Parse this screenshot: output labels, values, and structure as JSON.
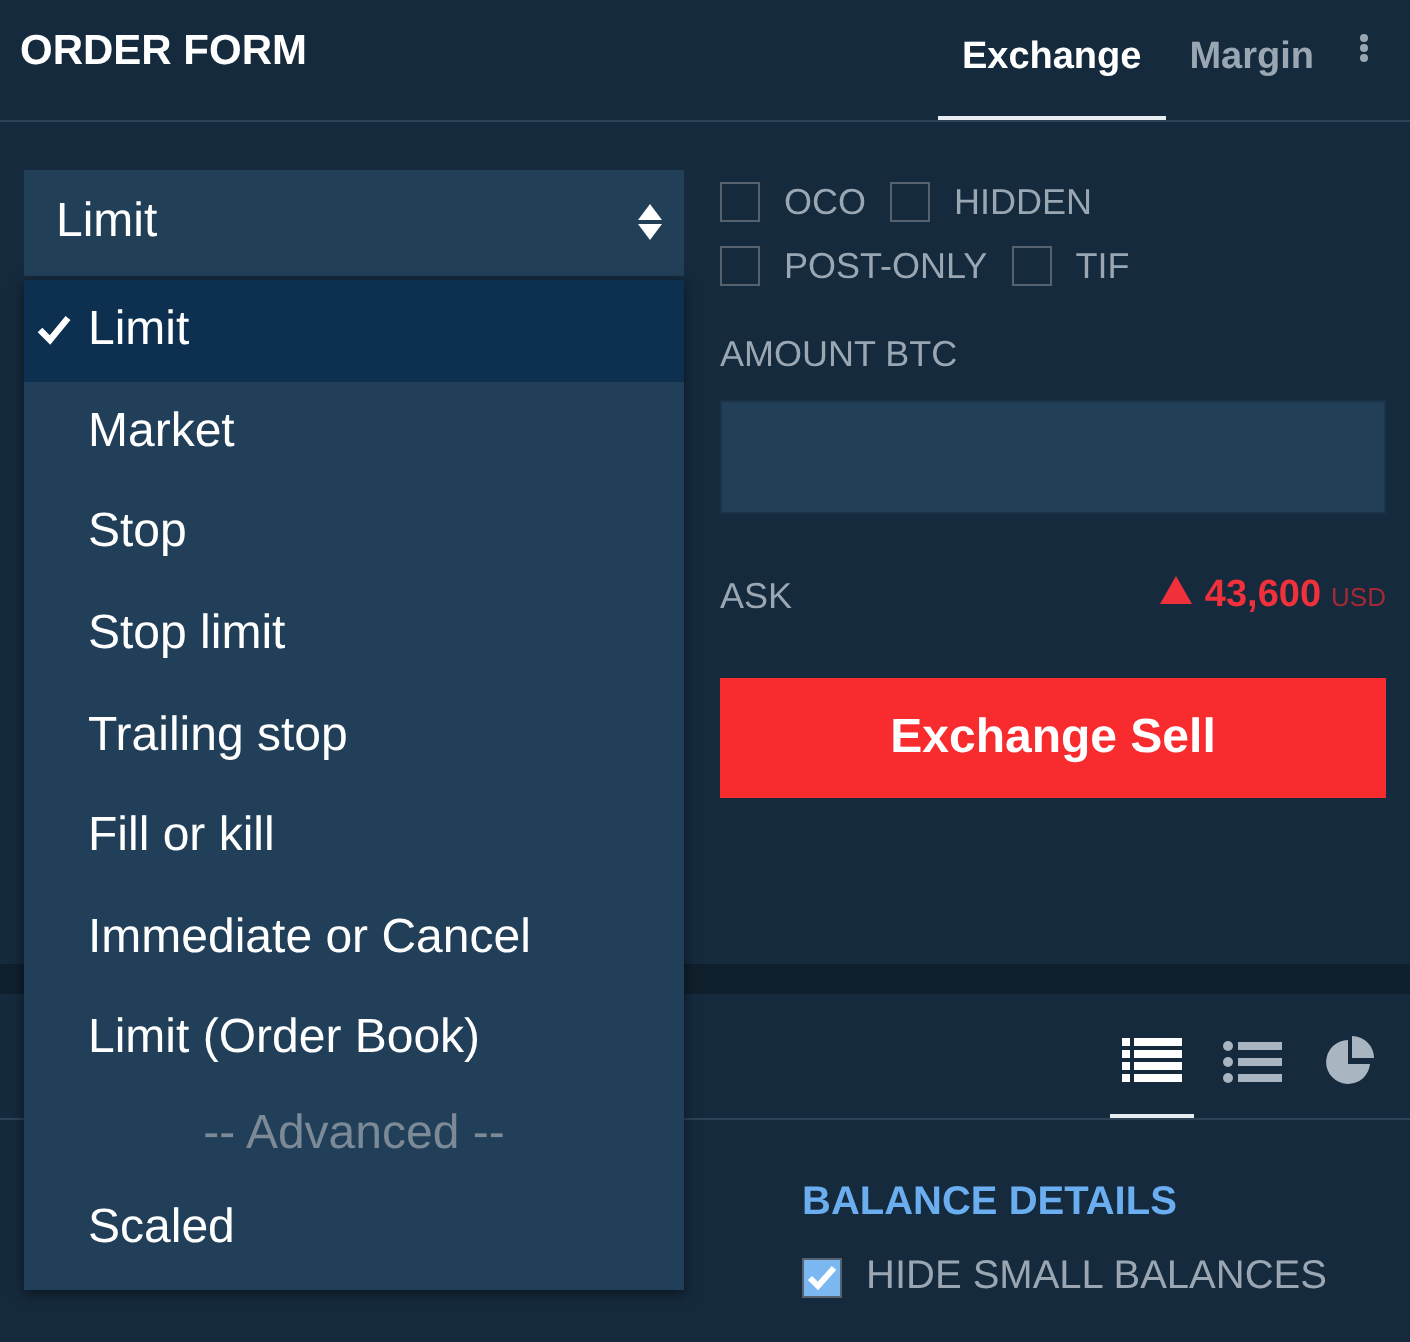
{
  "header": {
    "title": "ORDER FORM",
    "tabs": [
      {
        "label": "Exchange",
        "selected": true
      },
      {
        "label": "Margin",
        "selected": false
      }
    ]
  },
  "order_type": {
    "value": "Limit",
    "expanded": true,
    "options": [
      {
        "kind": "option",
        "label": "Limit",
        "selected": true
      },
      {
        "kind": "option",
        "label": "Market",
        "selected": false
      },
      {
        "kind": "option",
        "label": "Stop",
        "selected": false
      },
      {
        "kind": "option",
        "label": "Stop limit",
        "selected": false
      },
      {
        "kind": "option",
        "label": "Trailing stop",
        "selected": false
      },
      {
        "kind": "option",
        "label": "Fill or kill",
        "selected": false
      },
      {
        "kind": "option",
        "label": "Immediate or Cancel",
        "selected": false
      },
      {
        "kind": "option",
        "label": "Limit (Order Book)",
        "selected": false
      },
      {
        "kind": "separator",
        "label": "-- Advanced --"
      },
      {
        "kind": "option",
        "label": "Scaled",
        "selected": false
      }
    ]
  },
  "flags": [
    [
      {
        "label": "OCO",
        "checked": false
      },
      {
        "label": "HIDDEN",
        "checked": false
      }
    ],
    [
      {
        "label": "POST-ONLY",
        "checked": false
      },
      {
        "label": "TIF",
        "checked": false
      }
    ]
  ],
  "amount": {
    "label": "AMOUNT BTC"
  },
  "ask": {
    "label": "ASK",
    "value": "43,600",
    "currency": "USD"
  },
  "submit": {
    "label": "Exchange Sell"
  },
  "balances": {
    "views": [
      {
        "kind": "table",
        "selected": true
      },
      {
        "kind": "list",
        "selected": false
      },
      {
        "kind": "pie",
        "selected": false
      }
    ],
    "title": "BALANCE DETAILS",
    "hide_small": {
      "label": "HIDE SMALL BALANCES",
      "checked": true
    }
  }
}
